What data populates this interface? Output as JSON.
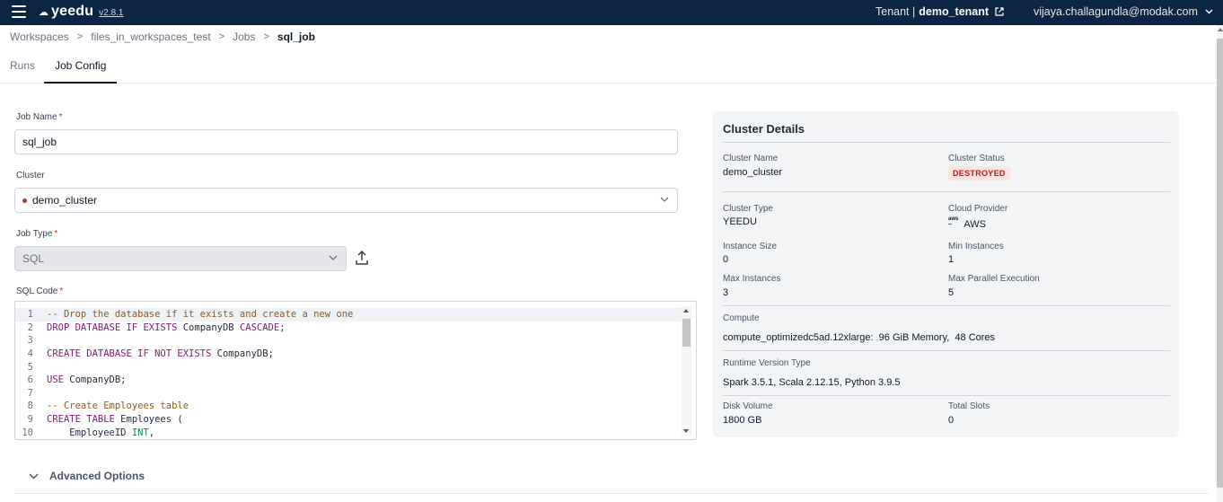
{
  "header": {
    "logo_text": "yeedu",
    "version": "v2.8.1",
    "tenant_label": "Tenant |",
    "tenant_name": "demo_tenant",
    "user_email": "vijaya.challagundla@modak.com"
  },
  "breadcrumb": [
    "Workspaces",
    "files_in_workspaces_test",
    "Jobs",
    "sql_job"
  ],
  "tabs": [
    "Runs",
    "Job Config"
  ],
  "form": {
    "job_name_label": "Job Name",
    "job_name_value": "sql_job",
    "cluster_label": "Cluster",
    "cluster_value": "demo_cluster",
    "job_type_label": "Job Type",
    "job_type_value": "SQL",
    "sql_code_label": "SQL Code"
  },
  "code_lines": [
    "-- Drop the database if it exists and create a new one",
    "DROP DATABASE IF EXISTS CompanyDB CASCADE;",
    "",
    "CREATE DATABASE IF NOT EXISTS CompanyDB;",
    "",
    "USE CompanyDB;",
    "",
    "-- Create Employees table",
    "CREATE TABLE Employees (",
    "    EmployeeID INT,"
  ],
  "advanced_options_label": "Advanced Options",
  "cluster_details": {
    "title": "Cluster Details",
    "cluster_name_label": "Cluster Name",
    "cluster_name": "demo_cluster",
    "cluster_status_label": "Cluster Status",
    "cluster_status": "DESTROYED",
    "cluster_type_label": "Cluster Type",
    "cluster_type": "YEEDU",
    "cloud_provider_label": "Cloud Provider",
    "cloud_provider": "AWS",
    "instance_size_label": "Instance Size",
    "instance_size": "0",
    "min_instances_label": "Min Instances",
    "min_instances": "1",
    "max_instances_label": "Max Instances",
    "max_instances": "3",
    "max_parallel_label": "Max Parallel Execution",
    "max_parallel": "5",
    "compute_label": "Compute",
    "compute": "compute_optimizedc5ad.12xlarge:  96 GiB Memory,  48 Cores",
    "runtime_label": "Runtime Version Type",
    "runtime": "Spark 3.5.1, Scala 2.12.15, Python 3.9.5",
    "disk_volume_label": "Disk Volume",
    "disk_volume": "1800 GB",
    "total_slots_label": "Total Slots",
    "total_slots": "0"
  },
  "colors": {
    "topbar": "#0b2545",
    "status_destroyed_bg": "#fde2e2",
    "status_destroyed_text": "#b91c1c",
    "required_marker": "#dc2626"
  }
}
